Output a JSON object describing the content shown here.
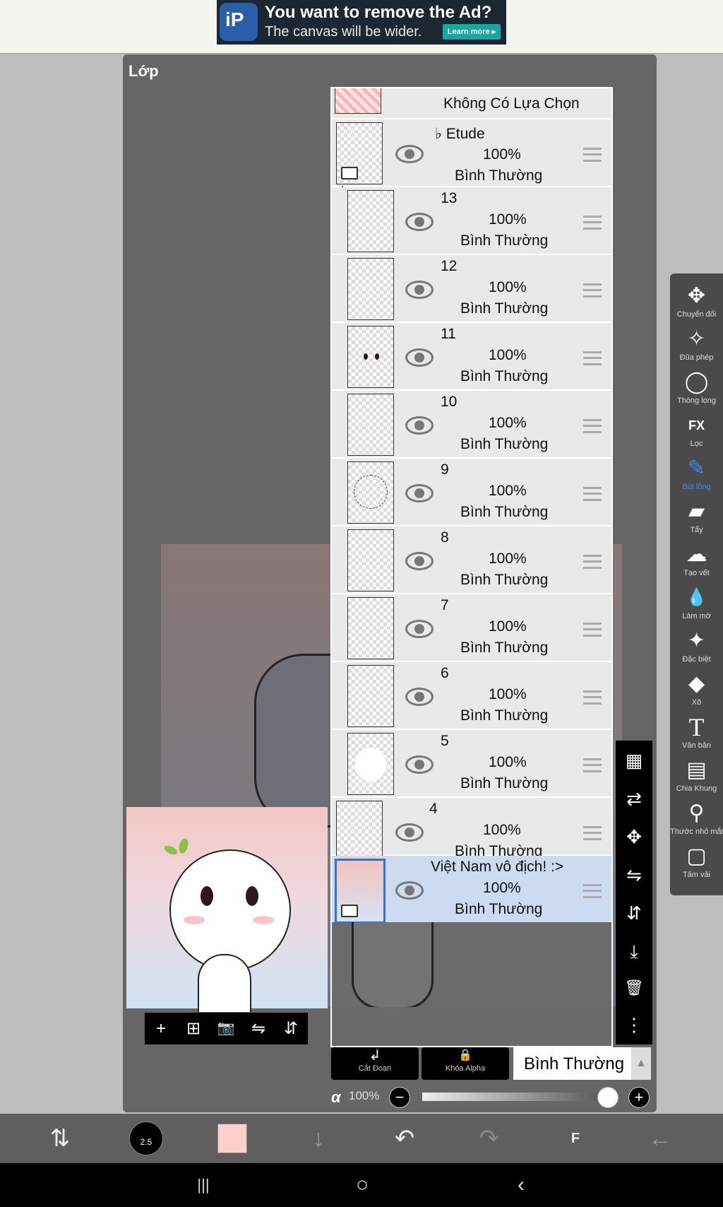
{
  "ad": {
    "title": "You want to remove the Ad?",
    "subtitle": "The canvas will be wider.",
    "cta": "Learn more ▸",
    "logo_text": "iP"
  },
  "panel": {
    "title": "Lớp"
  },
  "list": {
    "top_label": "Không Có Lựa Chọn",
    "folder": {
      "name": "♭ Etude",
      "opacity": "100%",
      "mode": "Bình Thường"
    },
    "layers": [
      {
        "name": "13",
        "opacity": "100%",
        "mode": "Bình Thường"
      },
      {
        "name": "12",
        "opacity": "100%",
        "mode": "Bình Thường"
      },
      {
        "name": "11",
        "opacity": "100%",
        "mode": "Bình Thường"
      },
      {
        "name": "10",
        "opacity": "100%",
        "mode": "Bình Thường"
      },
      {
        "name": "9",
        "opacity": "100%",
        "mode": "Bình Thường"
      },
      {
        "name": "8",
        "opacity": "100%",
        "mode": "Bình Thường"
      },
      {
        "name": "7",
        "opacity": "100%",
        "mode": "Bình Thường"
      },
      {
        "name": "6",
        "opacity": "100%",
        "mode": "Bình Thường"
      },
      {
        "name": "5",
        "opacity": "100%",
        "mode": "Bình Thường"
      }
    ],
    "layer4": {
      "name": "4",
      "opacity": "100%",
      "mode": "Bình Thường"
    },
    "selected": {
      "name": "Việt Nam vô địch! :>",
      "opacity": "100%",
      "mode": "Bình Thường"
    }
  },
  "preview_toolbar": [
    "+",
    "⊞",
    "📷",
    "⇋",
    "⇵"
  ],
  "right_strip": [
    "▦",
    "⇄",
    "✥",
    "⇋",
    "⇵",
    "⤓",
    "🗑",
    "⋮"
  ],
  "side_tools": [
    {
      "icon": "✥",
      "label": "Chuyển đổi"
    },
    {
      "icon": "✧",
      "label": "Đũa phép"
    },
    {
      "icon": "◯",
      "label": "Thòng lọng"
    },
    {
      "icon": "FX",
      "label": "Lọc"
    },
    {
      "icon": "✎",
      "label": "Bút lông"
    },
    {
      "icon": "▰",
      "label": "Tẩy"
    },
    {
      "icon": "☁",
      "label": "Tạo vết"
    },
    {
      "icon": "💧",
      "label": "Làm mờ"
    },
    {
      "icon": "✦",
      "label": "Đặc biệt"
    },
    {
      "icon": "◆",
      "label": "Xô"
    },
    {
      "icon": "T",
      "label": "Văn bản"
    },
    {
      "icon": "▤",
      "label": "Chia Khung"
    },
    {
      "icon": "⚲",
      "label": "Thước nhỏ mắt"
    },
    {
      "icon": "▢",
      "label": "Tấm vải"
    }
  ],
  "blend": {
    "clip_label": "Cắt Đoạn",
    "clip_icon": "↲",
    "alpha_lock_label": "Khóa Alpha",
    "alpha_lock_icon": "🔒",
    "mode": "Bình Thường",
    "arrow": "▲"
  },
  "alpha": {
    "symbol": "α",
    "value": "100%",
    "minus": "−",
    "plus": "+",
    "level": 1.0
  },
  "bottom_bar": {
    "brush_size": "2.5",
    "color": "#fbd0cb",
    "icons": [
      "⇅",
      "↓",
      "↶",
      "↷",
      "F",
      "←"
    ]
  },
  "nav": [
    "|||",
    "○",
    "‹"
  ]
}
